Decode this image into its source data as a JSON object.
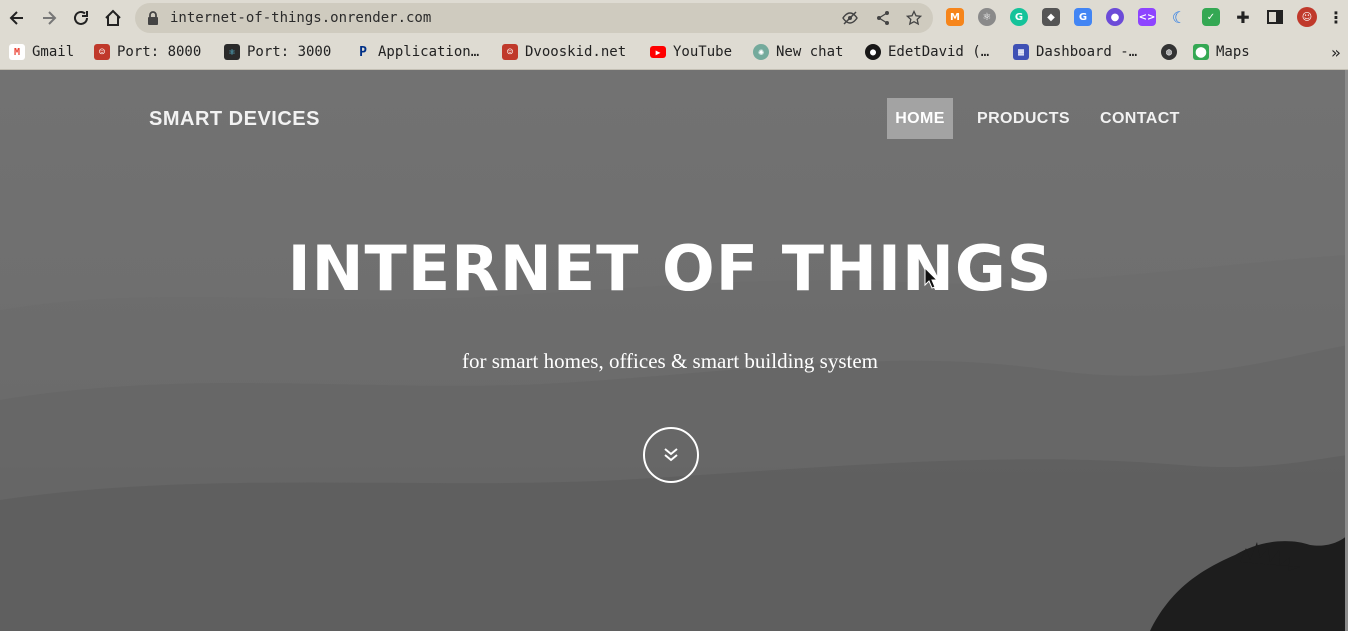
{
  "browser": {
    "url": "internet-of-things.onrender.com",
    "bookmarks": [
      {
        "label": "Gmail",
        "icon": "gmail-icon",
        "color": "#ea4335"
      },
      {
        "label": "Port: 8000",
        "icon": "avatar-icon",
        "color": "#c0392b"
      },
      {
        "label": "Port: 3000",
        "icon": "react-icon",
        "color": "#2a2a2a"
      },
      {
        "label": "Application…",
        "icon": "paypal-icon",
        "color": "#003087"
      },
      {
        "label": "Dvooskid.net",
        "icon": "avatar-icon",
        "color": "#c0392b"
      },
      {
        "label": "YouTube",
        "icon": "youtube-icon",
        "color": "#ff0000"
      },
      {
        "label": "New chat",
        "icon": "chatgpt-icon",
        "color": "#74aa9c"
      },
      {
        "label": "EdetDavid (…",
        "icon": "github-icon",
        "color": "#181717"
      },
      {
        "label": "Dashboard -…",
        "icon": "dashboard-icon",
        "color": "#3f51b5"
      },
      {
        "label": "",
        "icon": "globe-icon",
        "color": "#333333"
      },
      {
        "label": "Maps",
        "icon": "maps-icon",
        "color": "#34a853"
      }
    ],
    "overflow_glyph": "»"
  },
  "site": {
    "brand": "SMART DEVICES",
    "nav": {
      "home": "HOME",
      "products": "PRODUCTS",
      "contact": "CONTACT"
    },
    "hero": {
      "title": "INTERNET OF THINGS",
      "subtitle": "for smart homes, offices & smart building system"
    }
  },
  "colors": {
    "chrome": "#dedbd2",
    "nav_active_bg": "#a3a3a3",
    "hero_text": "#ffffff"
  }
}
